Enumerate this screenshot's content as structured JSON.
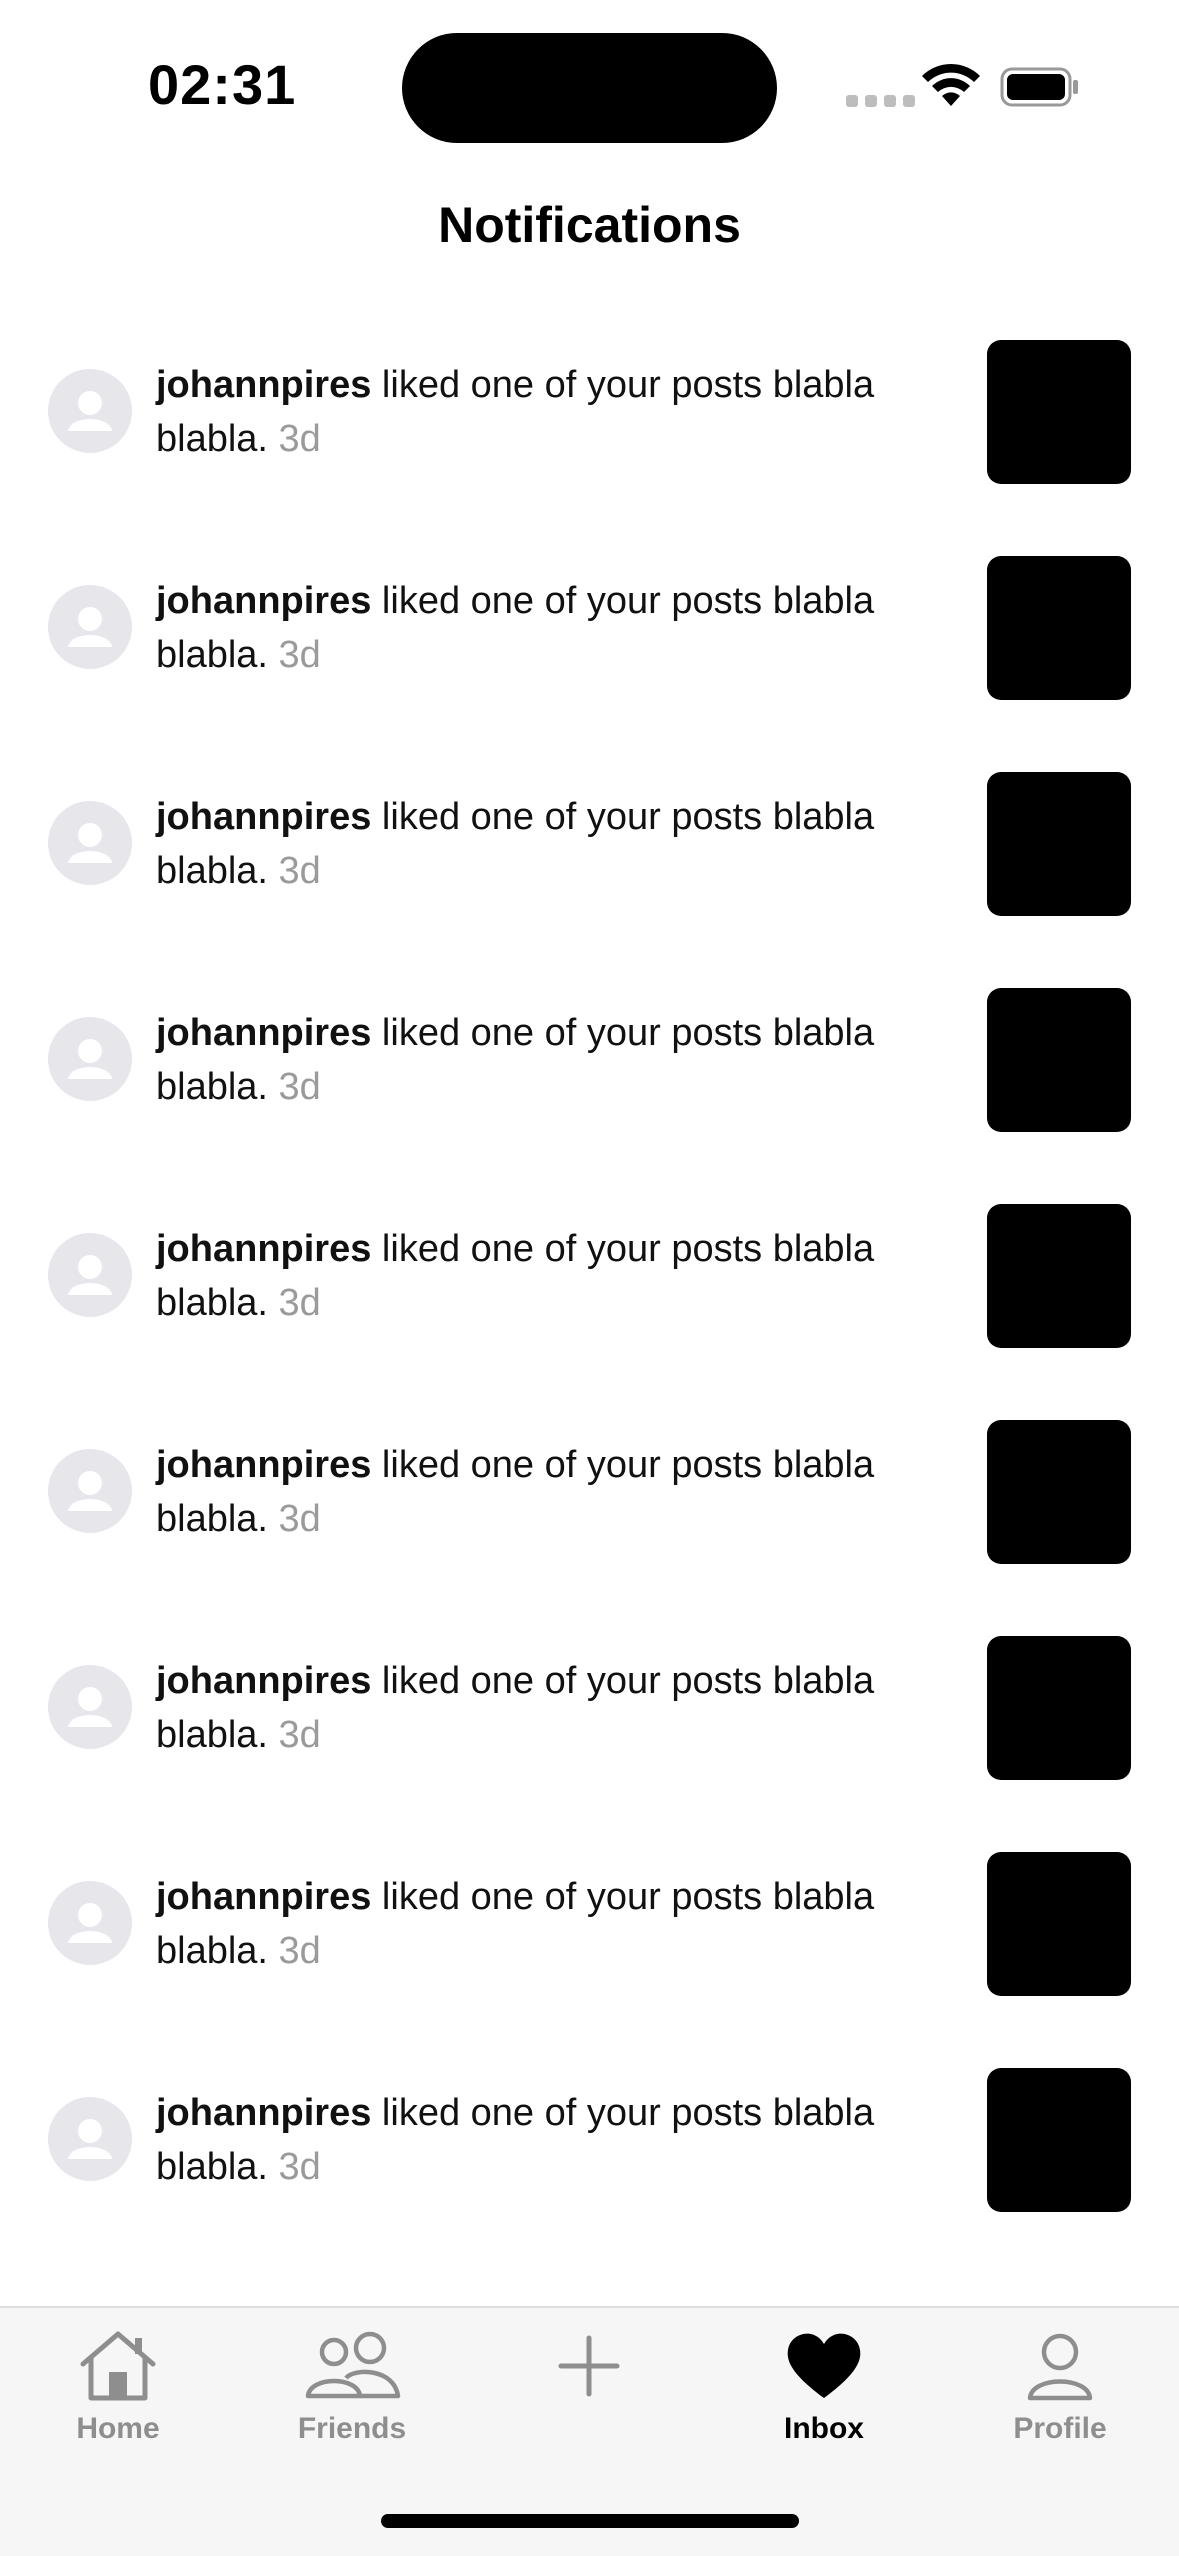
{
  "status_bar": {
    "time": "02:31"
  },
  "header": {
    "title": "Notifications"
  },
  "notifications": [
    {
      "user": "johannpires",
      "message": " liked one of your posts blabla blabla. ",
      "age": "3d"
    },
    {
      "user": "johannpires",
      "message": " liked one of your posts blabla blabla. ",
      "age": "3d"
    },
    {
      "user": "johannpires",
      "message": " liked one of your posts blabla blabla. ",
      "age": "3d"
    },
    {
      "user": "johannpires",
      "message": " liked one of your posts blabla blabla. ",
      "age": "3d"
    },
    {
      "user": "johannpires",
      "message": " liked one of your posts blabla blabla. ",
      "age": "3d"
    },
    {
      "user": "johannpires",
      "message": " liked one of your posts blabla blabla. ",
      "age": "3d"
    },
    {
      "user": "johannpires",
      "message": " liked one of your posts blabla blabla. ",
      "age": "3d"
    },
    {
      "user": "johannpires",
      "message": " liked one of your posts blabla blabla. ",
      "age": "3d"
    },
    {
      "user": "johannpires",
      "message": " liked one of your posts blabla blabla. ",
      "age": "3d"
    }
  ],
  "tab_bar": {
    "items": [
      {
        "label": "Home",
        "icon": "house-icon",
        "active": false
      },
      {
        "label": "Friends",
        "icon": "people-icon",
        "active": false
      },
      {
        "label": "",
        "icon": "plus-icon",
        "active": false
      },
      {
        "label": "Inbox",
        "icon": "heart-icon",
        "active": true
      },
      {
        "label": "Profile",
        "icon": "person-icon",
        "active": false
      }
    ]
  },
  "colors": {
    "accent": "#000000",
    "inactive_tab": "#8e8e8e",
    "avatar_bg": "#e6e6eb",
    "timestamp": "#9a9a9a"
  }
}
